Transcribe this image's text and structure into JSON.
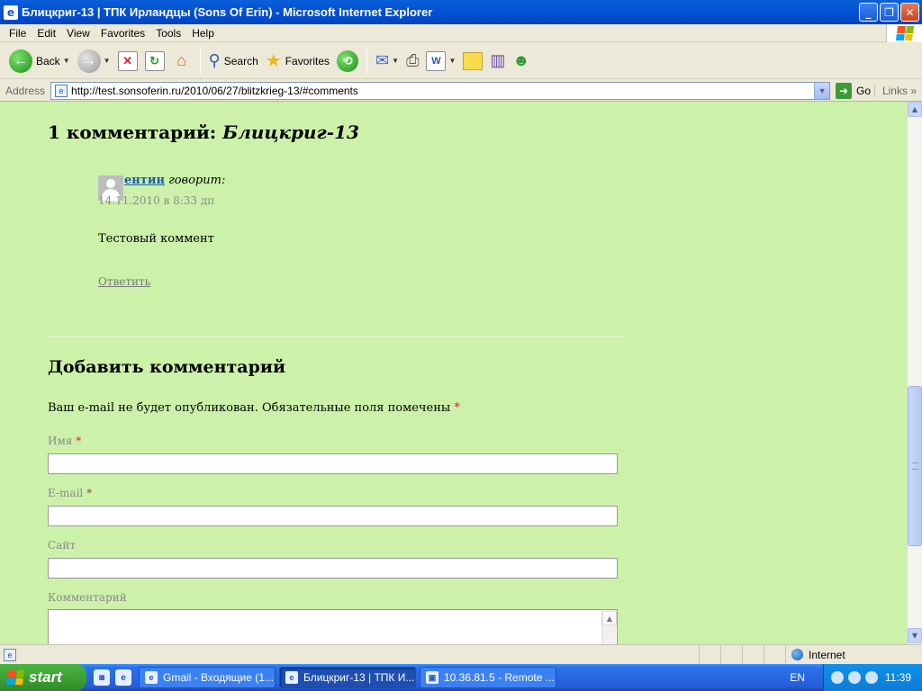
{
  "window": {
    "title": "Блицкриг-13 | ТПК Ирландцы (Sons Of Erin) - Microsoft Internet Explorer",
    "minimize": "_",
    "maximize": "❐",
    "close": "✕"
  },
  "menu": [
    "File",
    "Edit",
    "View",
    "Favorites",
    "Tools",
    "Help"
  ],
  "toolbar": {
    "back": "Back",
    "search": "Search",
    "favorites": "Favorites"
  },
  "address": {
    "label": "Address",
    "url": "http://test.sonsoferin.ru/2010/06/27/blitzkrieg-13/#comments",
    "go": "Go",
    "links": "Links"
  },
  "page": {
    "comments_title_prefix": "1 комментарий: ",
    "comments_title_post": "Блицкриг-13",
    "comment": {
      "author": "ентин",
      "says": "говорит:",
      "date": "14.11.2010 в 8:33 дп",
      "text": "Тестовый коммент",
      "reply": "Ответить"
    },
    "reply_title": "Добавить комментарий",
    "notes": "Ваш e-mail не будет опубликован. Обязательные поля помечены",
    "required_mark": "*",
    "fields": {
      "name": "Имя",
      "email": "E-mail",
      "site": "Сайт",
      "comment": "Комментарий"
    }
  },
  "status": {
    "zone": "Internet"
  },
  "taskbar": {
    "start": "start",
    "tasks": [
      "Gmail - Входящие (1...",
      "Блицкриг-13 | ТПК И...",
      "10.36.81.5 - Remote ..."
    ],
    "lang": "EN",
    "clock": "11:39"
  }
}
